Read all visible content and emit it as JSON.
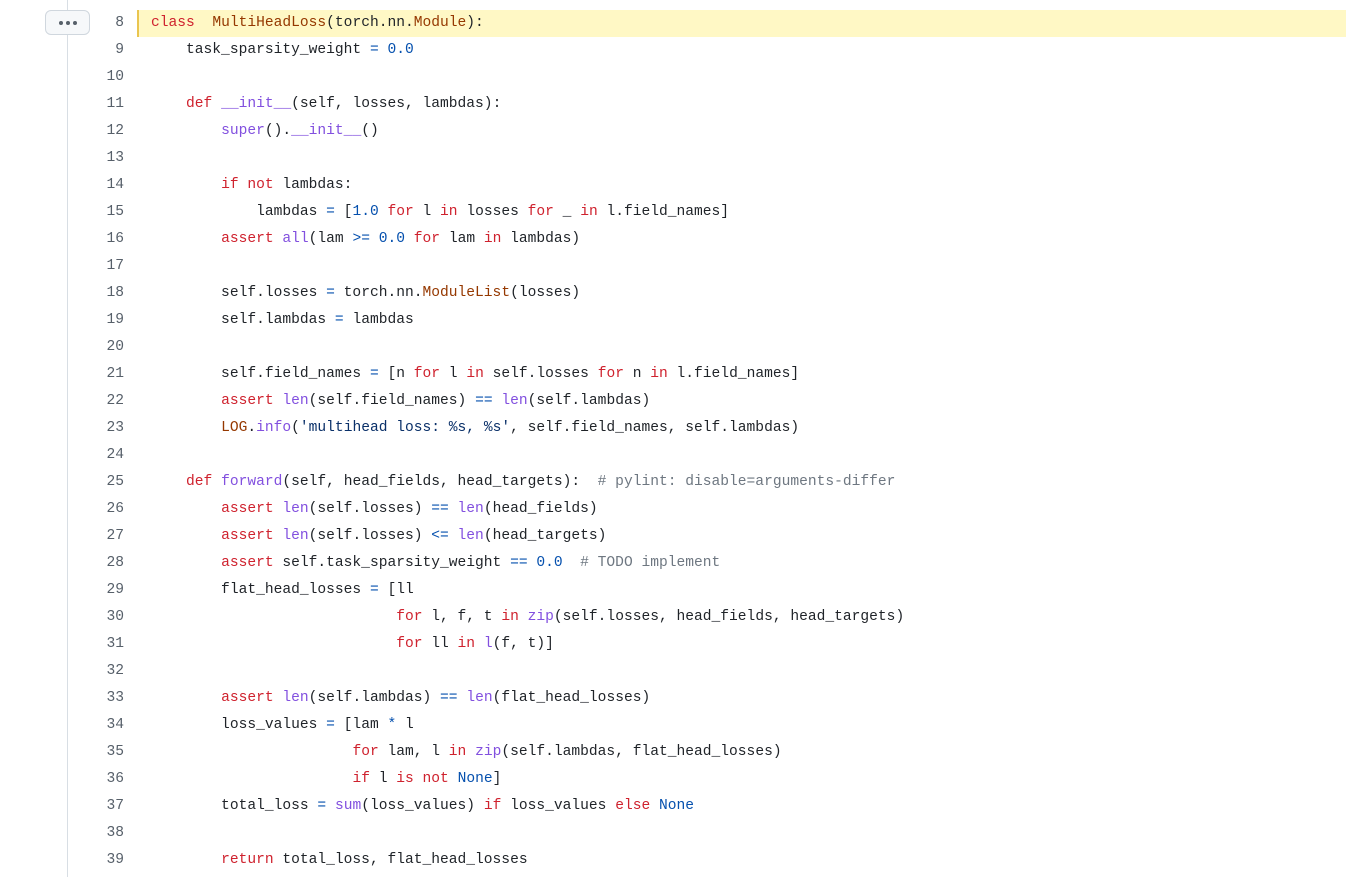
{
  "toolbar": {
    "more_label": "More options"
  },
  "colors": {
    "highlight_bg": "#fff8c5",
    "highlight_border": "#eac54f",
    "keyword": "#cf222e",
    "class_name": "#953800",
    "function": "#8250df",
    "number": "#0550ae",
    "comment": "#6e7781"
  },
  "code": {
    "highlighted_line": 8,
    "lines": [
      {
        "n": "8",
        "tokens": [
          [
            "kw",
            "class"
          ],
          [
            "",
            "  "
          ],
          [
            "cls",
            "MultiHeadLoss"
          ],
          [
            "",
            "(torch.nn."
          ],
          [
            "cls",
            "Module"
          ],
          [
            "",
            "):"
          ]
        ]
      },
      {
        "n": "9",
        "tokens": [
          [
            "",
            "    task_sparsity_weight "
          ],
          [
            "op",
            "="
          ],
          [
            "",
            " "
          ],
          [
            "num",
            "0.0"
          ]
        ]
      },
      {
        "n": "10",
        "tokens": []
      },
      {
        "n": "11",
        "tokens": [
          [
            "",
            "    "
          ],
          [
            "kw",
            "def"
          ],
          [
            "",
            " "
          ],
          [
            "fn",
            "__init__"
          ],
          [
            "",
            "(self, losses, lambdas):"
          ]
        ]
      },
      {
        "n": "12",
        "tokens": [
          [
            "",
            "        "
          ],
          [
            "bi",
            "super"
          ],
          [
            "",
            "()."
          ],
          [
            "fn",
            "__init__"
          ],
          [
            "",
            "()"
          ]
        ]
      },
      {
        "n": "13",
        "tokens": []
      },
      {
        "n": "14",
        "tokens": [
          [
            "",
            "        "
          ],
          [
            "kw",
            "if"
          ],
          [
            "",
            " "
          ],
          [
            "kw",
            "not"
          ],
          [
            "",
            " lambdas:"
          ]
        ]
      },
      {
        "n": "15",
        "tokens": [
          [
            "",
            "            lambdas "
          ],
          [
            "op",
            "="
          ],
          [
            "",
            " ["
          ],
          [
            "num",
            "1.0"
          ],
          [
            "",
            " "
          ],
          [
            "kw",
            "for"
          ],
          [
            "",
            " l "
          ],
          [
            "kw",
            "in"
          ],
          [
            "",
            " losses "
          ],
          [
            "kw",
            "for"
          ],
          [
            "",
            " _ "
          ],
          [
            "kw",
            "in"
          ],
          [
            "",
            " l.field_names]"
          ]
        ]
      },
      {
        "n": "16",
        "tokens": [
          [
            "",
            "        "
          ],
          [
            "kw",
            "assert"
          ],
          [
            "",
            " "
          ],
          [
            "bi",
            "all"
          ],
          [
            "",
            "(lam "
          ],
          [
            "op",
            ">="
          ],
          [
            "",
            " "
          ],
          [
            "num",
            "0.0"
          ],
          [
            "",
            " "
          ],
          [
            "kw",
            "for"
          ],
          [
            "",
            " lam "
          ],
          [
            "kw",
            "in"
          ],
          [
            "",
            " lambdas)"
          ]
        ]
      },
      {
        "n": "17",
        "tokens": []
      },
      {
        "n": "18",
        "tokens": [
          [
            "",
            "        self.losses "
          ],
          [
            "op",
            "="
          ],
          [
            "",
            " torch.nn."
          ],
          [
            "cls",
            "ModuleList"
          ],
          [
            "",
            "(losses)"
          ]
        ]
      },
      {
        "n": "19",
        "tokens": [
          [
            "",
            "        self.lambdas "
          ],
          [
            "op",
            "="
          ],
          [
            "",
            " lambdas"
          ]
        ]
      },
      {
        "n": "20",
        "tokens": []
      },
      {
        "n": "21",
        "tokens": [
          [
            "",
            "        self.field_names "
          ],
          [
            "op",
            "="
          ],
          [
            "",
            " [n "
          ],
          [
            "kw",
            "for"
          ],
          [
            "",
            " l "
          ],
          [
            "kw",
            "in"
          ],
          [
            "",
            " self.losses "
          ],
          [
            "kw",
            "for"
          ],
          [
            "",
            " n "
          ],
          [
            "kw",
            "in"
          ],
          [
            "",
            " l.field_names]"
          ]
        ]
      },
      {
        "n": "22",
        "tokens": [
          [
            "",
            "        "
          ],
          [
            "kw",
            "assert"
          ],
          [
            "",
            " "
          ],
          [
            "bi",
            "len"
          ],
          [
            "",
            "(self.field_names) "
          ],
          [
            "op",
            "=="
          ],
          [
            "",
            " "
          ],
          [
            "bi",
            "len"
          ],
          [
            "",
            "(self.lambdas)"
          ]
        ]
      },
      {
        "n": "23",
        "tokens": [
          [
            "",
            "        "
          ],
          [
            "cls",
            "LOG"
          ],
          [
            "",
            "."
          ],
          [
            "fn",
            "info"
          ],
          [
            "",
            "("
          ],
          [
            "str",
            "'multihead loss: %s, %s'"
          ],
          [
            "",
            ", self.field_names, self.lambdas)"
          ]
        ]
      },
      {
        "n": "24",
        "tokens": []
      },
      {
        "n": "25",
        "tokens": [
          [
            "",
            "    "
          ],
          [
            "kw",
            "def"
          ],
          [
            "",
            " "
          ],
          [
            "fn",
            "forward"
          ],
          [
            "",
            "(self, head_fields, head_targets):  "
          ],
          [
            "cmt",
            "# pylint: disable=arguments-differ"
          ]
        ]
      },
      {
        "n": "26",
        "tokens": [
          [
            "",
            "        "
          ],
          [
            "kw",
            "assert"
          ],
          [
            "",
            " "
          ],
          [
            "bi",
            "len"
          ],
          [
            "",
            "(self.losses) "
          ],
          [
            "op",
            "=="
          ],
          [
            "",
            " "
          ],
          [
            "bi",
            "len"
          ],
          [
            "",
            "(head_fields)"
          ]
        ]
      },
      {
        "n": "27",
        "tokens": [
          [
            "",
            "        "
          ],
          [
            "kw",
            "assert"
          ],
          [
            "",
            " "
          ],
          [
            "bi",
            "len"
          ],
          [
            "",
            "(self.losses) "
          ],
          [
            "op",
            "<="
          ],
          [
            "",
            " "
          ],
          [
            "bi",
            "len"
          ],
          [
            "",
            "(head_targets)"
          ]
        ]
      },
      {
        "n": "28",
        "tokens": [
          [
            "",
            "        "
          ],
          [
            "kw",
            "assert"
          ],
          [
            "",
            " self.task_sparsity_weight "
          ],
          [
            "op",
            "=="
          ],
          [
            "",
            " "
          ],
          [
            "num",
            "0.0"
          ],
          [
            "",
            "  "
          ],
          [
            "cmt",
            "# TODO implement"
          ]
        ]
      },
      {
        "n": "29",
        "tokens": [
          [
            "",
            "        flat_head_losses "
          ],
          [
            "op",
            "="
          ],
          [
            "",
            " [ll"
          ]
        ]
      },
      {
        "n": "30",
        "tokens": [
          [
            "",
            "                            "
          ],
          [
            "kw",
            "for"
          ],
          [
            "",
            " l, f, t "
          ],
          [
            "kw",
            "in"
          ],
          [
            "",
            " "
          ],
          [
            "bi",
            "zip"
          ],
          [
            "",
            "(self.losses, head_fields, head_targets)"
          ]
        ]
      },
      {
        "n": "31",
        "tokens": [
          [
            "",
            "                            "
          ],
          [
            "kw",
            "for"
          ],
          [
            "",
            " ll "
          ],
          [
            "kw",
            "in"
          ],
          [
            "",
            " "
          ],
          [
            "fn",
            "l"
          ],
          [
            "",
            "(f, t)]"
          ]
        ]
      },
      {
        "n": "32",
        "tokens": []
      },
      {
        "n": "33",
        "tokens": [
          [
            "",
            "        "
          ],
          [
            "kw",
            "assert"
          ],
          [
            "",
            " "
          ],
          [
            "bi",
            "len"
          ],
          [
            "",
            "(self.lambdas) "
          ],
          [
            "op",
            "=="
          ],
          [
            "",
            " "
          ],
          [
            "bi",
            "len"
          ],
          [
            "",
            "(flat_head_losses)"
          ]
        ]
      },
      {
        "n": "34",
        "tokens": [
          [
            "",
            "        loss_values "
          ],
          [
            "op",
            "="
          ],
          [
            "",
            " [lam "
          ],
          [
            "op",
            "*"
          ],
          [
            "",
            " l"
          ]
        ]
      },
      {
        "n": "35",
        "tokens": [
          [
            "",
            "                       "
          ],
          [
            "kw",
            "for"
          ],
          [
            "",
            " lam, l "
          ],
          [
            "kw",
            "in"
          ],
          [
            "",
            " "
          ],
          [
            "bi",
            "zip"
          ],
          [
            "",
            "(self.lambdas, flat_head_losses)"
          ]
        ]
      },
      {
        "n": "36",
        "tokens": [
          [
            "",
            "                       "
          ],
          [
            "kw",
            "if"
          ],
          [
            "",
            " l "
          ],
          [
            "kw",
            "is"
          ],
          [
            "",
            " "
          ],
          [
            "kw",
            "not"
          ],
          [
            "",
            " "
          ],
          [
            "const",
            "None"
          ],
          [
            "",
            "]"
          ]
        ]
      },
      {
        "n": "37",
        "tokens": [
          [
            "",
            "        total_loss "
          ],
          [
            "op",
            "="
          ],
          [
            "",
            " "
          ],
          [
            "bi",
            "sum"
          ],
          [
            "",
            "(loss_values) "
          ],
          [
            "kw",
            "if"
          ],
          [
            "",
            " loss_values "
          ],
          [
            "kw",
            "else"
          ],
          [
            "",
            " "
          ],
          [
            "const",
            "None"
          ]
        ]
      },
      {
        "n": "38",
        "tokens": []
      },
      {
        "n": "39",
        "tokens": [
          [
            "",
            "        "
          ],
          [
            "kw",
            "return"
          ],
          [
            "",
            " total_loss, flat_head_losses"
          ]
        ]
      }
    ]
  }
}
